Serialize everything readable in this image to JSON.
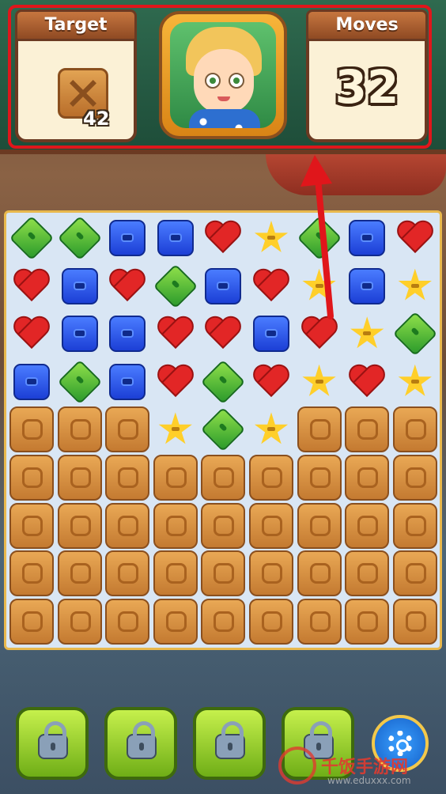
{
  "header": {
    "target_label": "Target",
    "target_count": "42",
    "target_icon": "wooden-crate-icon",
    "moves_label": "Moves",
    "moves_value": "32",
    "avatar": "girl-character-portrait"
  },
  "board": {
    "rows": 9,
    "cols": 9,
    "pieces": [
      [
        "green",
        "green",
        "blue",
        "blue",
        "red",
        "yellow",
        "green",
        "blue",
        "red"
      ],
      [
        "red",
        "blue",
        "red",
        "green",
        "blue",
        "red",
        "yellow",
        "blue",
        "yellow"
      ],
      [
        "red",
        "blue",
        "blue",
        "red",
        "red",
        "blue",
        "red",
        "yellow",
        "green"
      ],
      [
        "blue",
        "green",
        "blue",
        "red",
        "green",
        "red",
        "yellow",
        "red",
        "yellow"
      ],
      [
        "crate",
        "crate",
        "crate",
        "yellow",
        "green",
        "yellow",
        "crate",
        "crate",
        "crate"
      ],
      [
        "crate",
        "crate",
        "crate",
        "crate",
        "crate",
        "crate",
        "crate",
        "crate",
        "crate"
      ],
      [
        "crate",
        "crate",
        "crate",
        "crate",
        "crate",
        "crate",
        "crate",
        "crate",
        "crate"
      ],
      [
        "crate",
        "crate",
        "crate",
        "crate",
        "crate",
        "crate",
        "crate",
        "crate",
        "crate"
      ],
      [
        "crate",
        "crate",
        "crate",
        "crate",
        "crate",
        "crate",
        "crate",
        "crate",
        "crate"
      ]
    ],
    "piece_legend": {
      "green": "green-diamond-button",
      "blue": "blue-square-button",
      "red": "red-heart-button",
      "yellow": "yellow-star-button",
      "crate": "wooden-crate-block"
    }
  },
  "boosters": [
    {
      "icon": "lock-icon",
      "state": "locked"
    },
    {
      "icon": "lock-icon",
      "state": "locked"
    },
    {
      "icon": "lock-icon",
      "state": "locked"
    },
    {
      "icon": "lock-icon",
      "state": "locked"
    }
  ],
  "settings_icon": "gear-icon",
  "annotation": {
    "highlight_color": "#e0161b",
    "arrow_color": "#e0161b"
  },
  "watermark": {
    "text": "千饭手游网",
    "url": "www.eduxxx.com"
  }
}
